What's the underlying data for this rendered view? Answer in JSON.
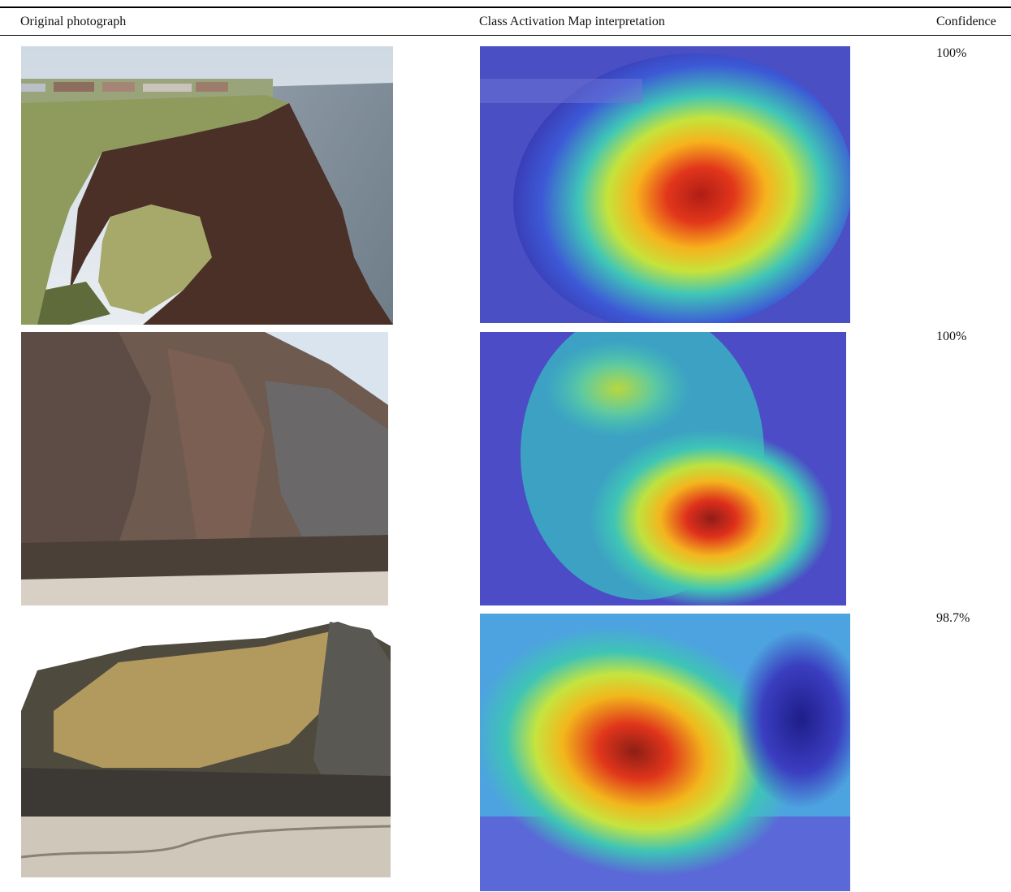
{
  "table": {
    "headers": {
      "original": "Original photograph",
      "cam": "Class Activation Map interpretation",
      "confidence": "Confidence"
    },
    "rows": [
      {
        "confidence": "100%"
      },
      {
        "confidence": "100%"
      },
      {
        "confidence": "98.7%"
      }
    ]
  },
  "colors": {
    "rule": "#000000",
    "cam_hot": "#d9261c",
    "cam_warm": "#f5d21a",
    "cam_mid": "#2ec4c0",
    "cam_cool": "#3a3fd1"
  }
}
